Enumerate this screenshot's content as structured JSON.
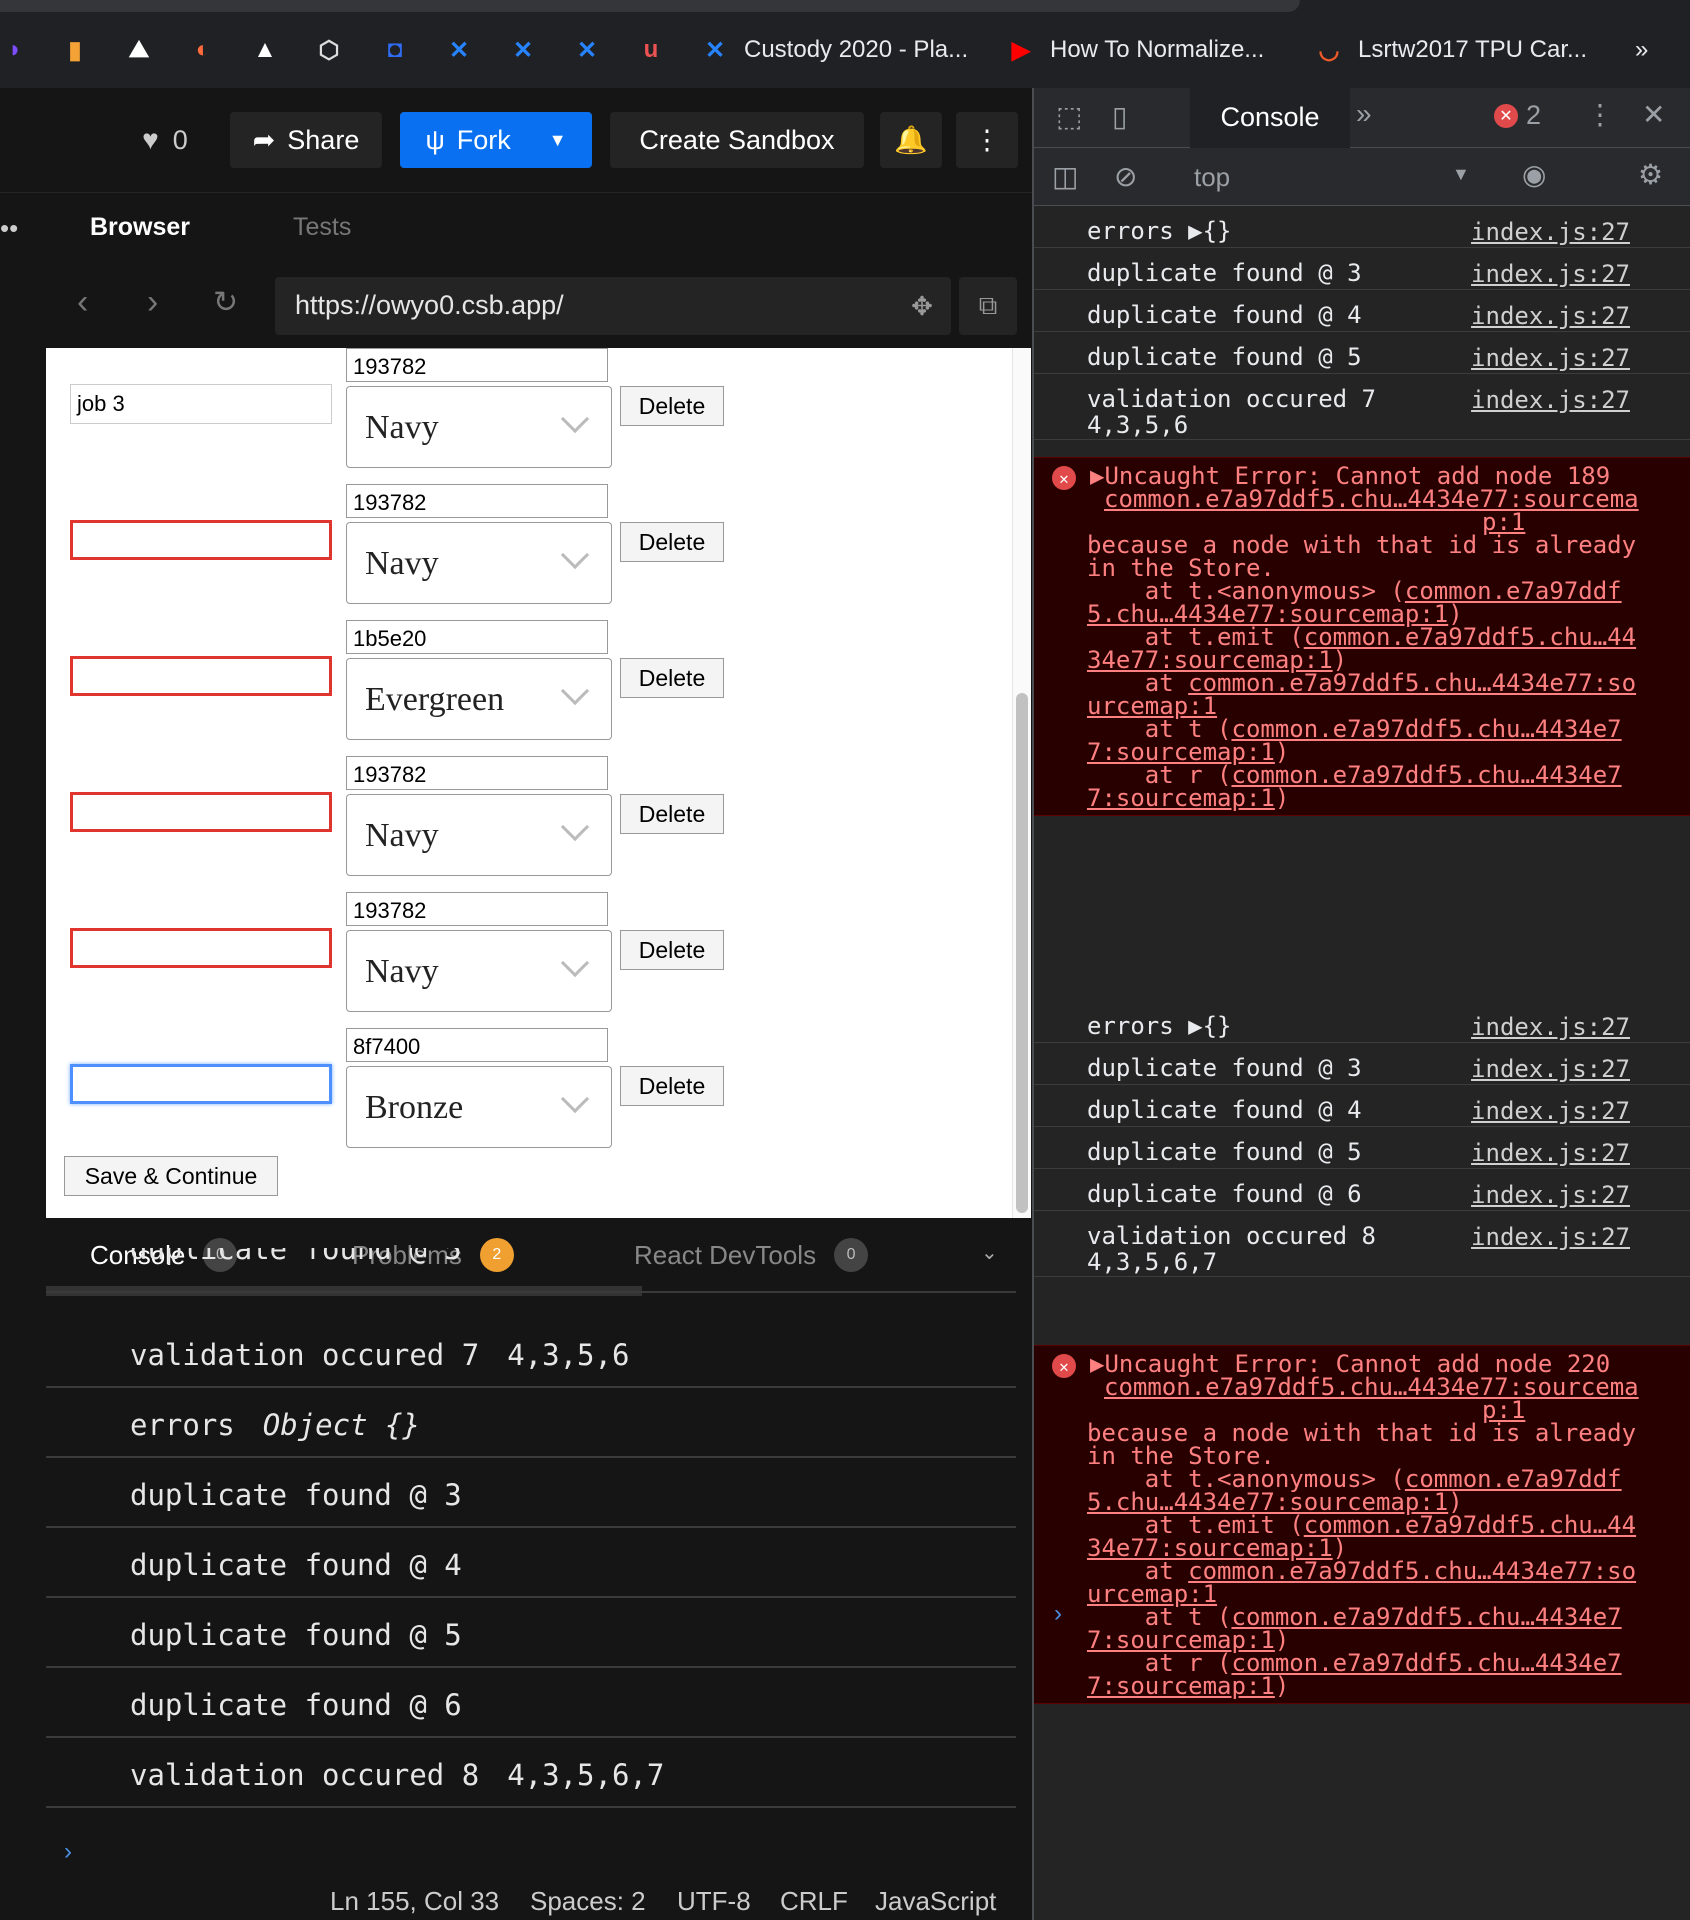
{
  "bookmarks": [
    {
      "icon": "bookmark-icon",
      "label": ""
    },
    {
      "icon": "analytics-icon",
      "label": ""
    },
    {
      "icon": "app-icon",
      "label": ""
    },
    {
      "icon": "circle-icon",
      "label": ""
    },
    {
      "icon": "triangle-icon",
      "label": ""
    },
    {
      "icon": "cube-icon",
      "label": ""
    },
    {
      "icon": "shield-icon",
      "label": ""
    },
    {
      "icon": "confluence-icon",
      "label": ""
    },
    {
      "icon": "confluence-icon",
      "label": ""
    },
    {
      "icon": "confluence-icon",
      "label": ""
    },
    {
      "icon": "udemy-icon",
      "label": ""
    },
    {
      "icon": "confluence-icon",
      "label": "Custody 2020 - Pla..."
    },
    {
      "icon": "youtube-icon",
      "label": "How To Normalize..."
    },
    {
      "icon": "store-icon",
      "label": "Lsrtw2017 TPU Car..."
    }
  ],
  "bookmarks_more": "»",
  "header": {
    "likes": "0",
    "share": "Share",
    "fork": "Fork",
    "create_sandbox": "Create Sandbox"
  },
  "panel_tabs": {
    "browser": "Browser",
    "tests": "Tests"
  },
  "browser": {
    "url": "https://owyo0.csb.app/"
  },
  "form": {
    "rows": [
      {
        "job": "job 3",
        "hex": "193782",
        "color": "Navy",
        "state": "normal"
      },
      {
        "job": "",
        "hex": "193782",
        "color": "Navy",
        "state": "error"
      },
      {
        "job": "",
        "hex": "1b5e20",
        "color": "Evergreen",
        "state": "error"
      },
      {
        "job": "",
        "hex": "193782",
        "color": "Navy",
        "state": "error"
      },
      {
        "job": "",
        "hex": "193782",
        "color": "Navy",
        "state": "error"
      },
      {
        "job": "",
        "hex": "8f7400",
        "color": "Bronze",
        "state": "focus"
      }
    ],
    "delete_label": "Delete",
    "save_label": "Save & Continue"
  },
  "console_tabs": [
    {
      "label": "Console",
      "count": "0"
    },
    {
      "label": "Problems",
      "count": "2"
    },
    {
      "label": "React DevTools",
      "count": "0"
    }
  ],
  "console_logs": [
    {
      "msg": "duplicate found @ 5",
      "value": ""
    },
    {
      "msg": "validation occured 7",
      "value": "4,3,5,6"
    },
    {
      "msg": "errors",
      "value": "Object {}"
    },
    {
      "msg": "duplicate found @ 3",
      "value": ""
    },
    {
      "msg": "duplicate found @ 4",
      "value": ""
    },
    {
      "msg": "duplicate found @ 5",
      "value": ""
    },
    {
      "msg": "duplicate found @ 6",
      "value": ""
    },
    {
      "msg": "validation occured 8",
      "value": "4,3,5,6,7"
    }
  ],
  "status_bar": {
    "position": "Ln 155, Col 33",
    "spaces": "Spaces: 2",
    "encoding": "UTF-8",
    "eol": "CRLF",
    "language": "JavaScript"
  },
  "devtools": {
    "tab": "Console",
    "error_count": "2",
    "context": "top",
    "source": "index.js:27",
    "group1": [
      {
        "msg": "errors ▶{}"
      },
      {
        "msg": "duplicate found @ 3"
      },
      {
        "msg": "duplicate found @ 4"
      },
      {
        "msg": "duplicate found @ 5"
      },
      {
        "msg": "validation occured 7\n4,3,5,6"
      }
    ],
    "error1": {
      "head": "▶Uncaught Error: Cannot add node 189",
      "link1": "common.e7a97ddf5.chu…4434e77:sourcema",
      "link1b": "p:1",
      "body1": "because a node with that id is already",
      "body2": "in the Store.",
      "trace": [
        [
          "    at t.<anonymous> (",
          "common.e7a97ddf",
          ""
        ],
        [
          "",
          "5.chu…4434e77:sourcemap:1",
          ")"
        ],
        [
          "    at t.emit (",
          "common.e7a97ddf5.chu…44",
          ""
        ],
        [
          "",
          "34e77:sourcemap:1",
          ")"
        ],
        [
          "    at ",
          "common.e7a97ddf5.chu…4434e77:so",
          ""
        ],
        [
          "",
          "urcemap:1",
          ""
        ],
        [
          "    at t (",
          "common.e7a97ddf5.chu…4434e7",
          ""
        ],
        [
          "",
          "7:sourcemap:1",
          ")"
        ],
        [
          "    at r (",
          "common.e7a97ddf5.chu…4434e7",
          ""
        ],
        [
          "",
          "7:sourcemap:1",
          ")"
        ]
      ]
    },
    "group2": [
      {
        "msg": "errors ▶{}"
      },
      {
        "msg": "duplicate found @ 3"
      },
      {
        "msg": "duplicate found @ 4"
      },
      {
        "msg": "duplicate found @ 5"
      },
      {
        "msg": "duplicate found @ 6"
      },
      {
        "msg": "validation occured 8\n4,3,5,6,7"
      }
    ],
    "error2": {
      "head": "▶Uncaught Error: Cannot add node 220"
    },
    "prompt": "›"
  },
  "colors": {
    "accent": "#0971f1",
    "error_bg": "#290000",
    "error_text": "#ff8080",
    "error_border": "#e0342e",
    "focus_border": "#4d90fe"
  }
}
